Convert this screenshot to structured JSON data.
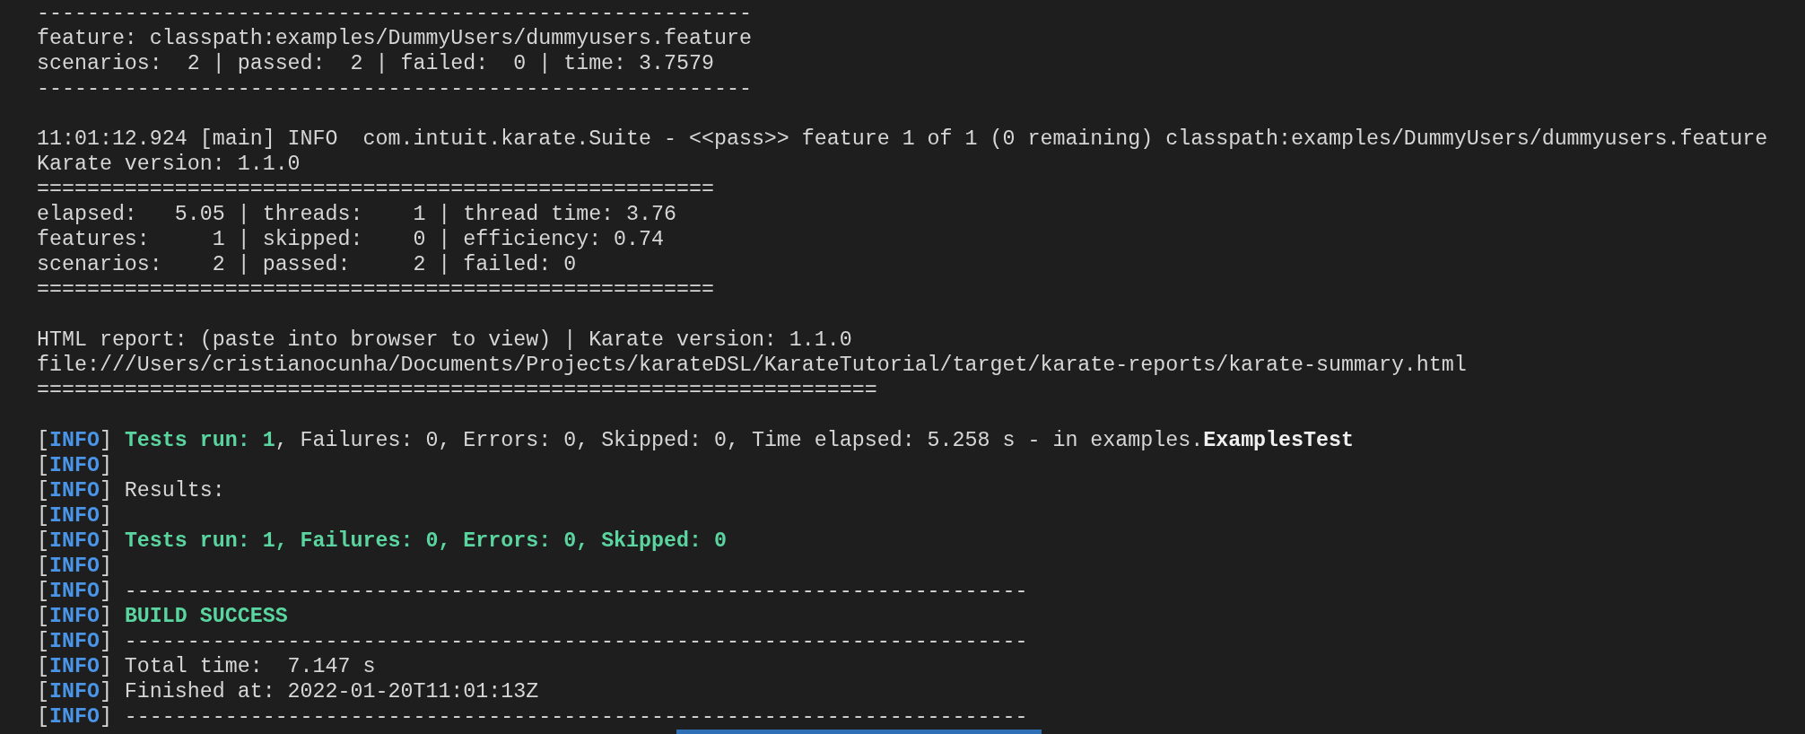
{
  "blocks": [
    {
      "lines": [
        {
          "segments": [
            {
              "kind": "plain",
              "text": "---------------------------------------------------------"
            }
          ]
        },
        {
          "segments": [
            {
              "kind": "plain",
              "text": "feature: classpath:examples/DummyUsers/dummyusers.feature"
            }
          ]
        },
        {
          "segments": [
            {
              "kind": "plain",
              "text": "scenarios:  2 | passed:  2 | failed:  0 | time: 3.7579"
            }
          ]
        },
        {
          "segments": [
            {
              "kind": "plain",
              "text": "---------------------------------------------------------"
            }
          ]
        }
      ]
    },
    {
      "lines": [
        {
          "segments": [
            {
              "kind": "plain",
              "text": "11:01:12.924 [main] INFO  com.intuit.karate.Suite - <<pass>> feature 1 of 1 (0 remaining) classpath:examples/DummyUsers/dummyusers.feature"
            }
          ]
        },
        {
          "segments": [
            {
              "kind": "plain",
              "text": "Karate version: 1.1.0"
            }
          ]
        },
        {
          "segments": [
            {
              "kind": "plain",
              "text": "======================================================"
            }
          ]
        },
        {
          "segments": [
            {
              "kind": "plain",
              "text": "elapsed:   5.05 | threads:    1 | thread time: 3.76"
            }
          ]
        },
        {
          "segments": [
            {
              "kind": "plain",
              "text": "features:     1 | skipped:    0 | efficiency: 0.74"
            }
          ]
        },
        {
          "segments": [
            {
              "kind": "plain",
              "text": "scenarios:    2 | passed:     2 | failed: 0"
            }
          ]
        },
        {
          "segments": [
            {
              "kind": "plain",
              "text": "======================================================"
            }
          ]
        }
      ]
    },
    {
      "lines": [
        {
          "segments": [
            {
              "kind": "plain",
              "text": "HTML report: (paste into browser to view) | Karate version: 1.1.0"
            }
          ]
        },
        {
          "segments": [
            {
              "kind": "plain",
              "text": "file:///Users/cristianocunha/Documents/Projects/karateDSL/KarateTutorial/target/karate-reports/karate-summary.html"
            }
          ]
        },
        {
          "segments": [
            {
              "kind": "plain",
              "text": "==================================================================="
            }
          ]
        }
      ]
    },
    {
      "lines": [
        {
          "segments": [
            {
              "kind": "plain",
              "text": "["
            },
            {
              "kind": "tag",
              "text": "INFO"
            },
            {
              "kind": "plain",
              "text": "] "
            },
            {
              "kind": "success",
              "text": "Tests run: 1"
            },
            {
              "kind": "plain",
              "text": ", Failures: 0, Errors: 0, Skipped: 0, Time elapsed: 5.258 s - in examples."
            },
            {
              "kind": "bold",
              "text": "ExamplesTest"
            }
          ]
        },
        {
          "segments": [
            {
              "kind": "plain",
              "text": "["
            },
            {
              "kind": "tag",
              "text": "INFO"
            },
            {
              "kind": "plain",
              "text": "]"
            }
          ]
        },
        {
          "segments": [
            {
              "kind": "plain",
              "text": "["
            },
            {
              "kind": "tag",
              "text": "INFO"
            },
            {
              "kind": "plain",
              "text": "] Results:"
            }
          ]
        },
        {
          "segments": [
            {
              "kind": "plain",
              "text": "["
            },
            {
              "kind": "tag",
              "text": "INFO"
            },
            {
              "kind": "plain",
              "text": "]"
            }
          ]
        },
        {
          "segments": [
            {
              "kind": "plain",
              "text": "["
            },
            {
              "kind": "tag",
              "text": "INFO"
            },
            {
              "kind": "plain",
              "text": "] "
            },
            {
              "kind": "success",
              "text": "Tests run: 1, Failures: 0, Errors: 0, Skipped: 0"
            }
          ]
        },
        {
          "segments": [
            {
              "kind": "plain",
              "text": "["
            },
            {
              "kind": "tag",
              "text": "INFO"
            },
            {
              "kind": "plain",
              "text": "]"
            }
          ]
        },
        {
          "segments": [
            {
              "kind": "plain",
              "text": "["
            },
            {
              "kind": "tag",
              "text": "INFO"
            },
            {
              "kind": "plain",
              "text": "] ------------------------------------------------------------------------"
            }
          ]
        },
        {
          "segments": [
            {
              "kind": "plain",
              "text": "["
            },
            {
              "kind": "tag",
              "text": "INFO"
            },
            {
              "kind": "plain",
              "text": "] "
            },
            {
              "kind": "success",
              "text": "BUILD SUCCESS"
            }
          ]
        },
        {
          "segments": [
            {
              "kind": "plain",
              "text": "["
            },
            {
              "kind": "tag",
              "text": "INFO"
            },
            {
              "kind": "plain",
              "text": "] ------------------------------------------------------------------------"
            }
          ]
        },
        {
          "segments": [
            {
              "kind": "plain",
              "text": "["
            },
            {
              "kind": "tag",
              "text": "INFO"
            },
            {
              "kind": "plain",
              "text": "] Total time:  7.147 s"
            }
          ]
        },
        {
          "segments": [
            {
              "kind": "plain",
              "text": "["
            },
            {
              "kind": "tag",
              "text": "INFO"
            },
            {
              "kind": "plain",
              "text": "] Finished at: 2022-01-20T11:01:13Z"
            }
          ]
        },
        {
          "segments": [
            {
              "kind": "plain",
              "text": "["
            },
            {
              "kind": "tag",
              "text": "INFO"
            },
            {
              "kind": "plain",
              "text": "] ------------------------------------------------------------------------"
            }
          ]
        }
      ]
    }
  ]
}
